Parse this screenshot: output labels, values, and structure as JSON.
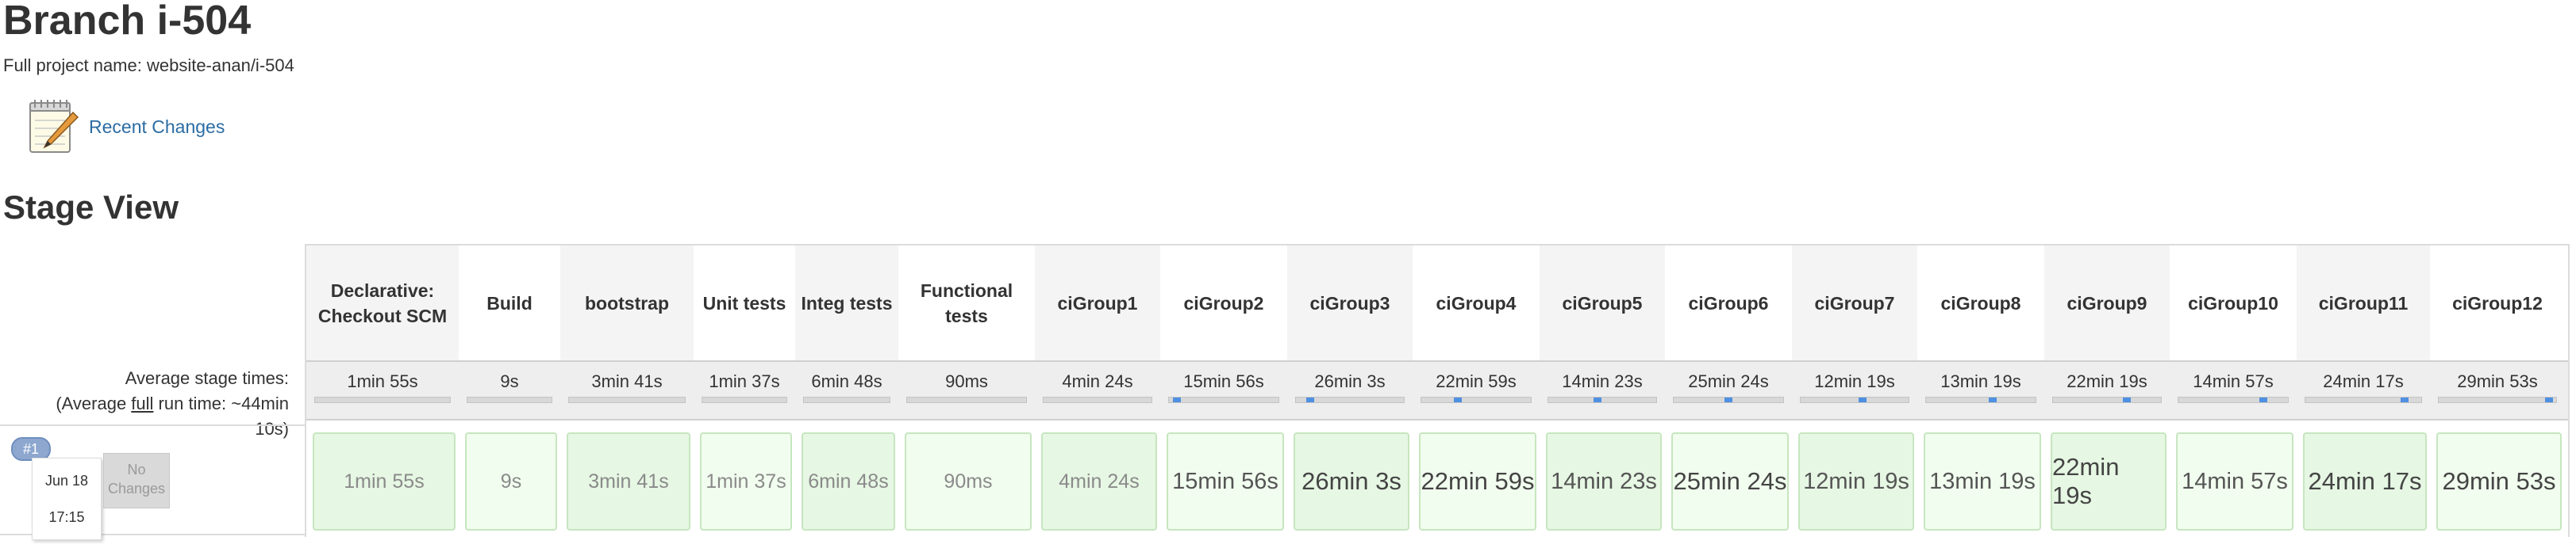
{
  "page": {
    "title": "Branch i-504",
    "full_name": "Full project name: website-anan/i-504",
    "recent_changes": "Recent Changes",
    "section_title": "Stage View"
  },
  "avg": {
    "line1": "Average stage times:",
    "line2_pre": "(Average ",
    "line2_link": "full",
    "line2_post": " run time: ~44min",
    "line3": "10s)"
  },
  "build": {
    "badge": "#1",
    "date": "Jun 18",
    "time": "17:15",
    "no_changes": "No Changes"
  },
  "stages": [
    {
      "name": "Declarative: Checkout SCM",
      "avg": "1min 55s",
      "run": "1min 55s",
      "progress": 0
    },
    {
      "name": "Build",
      "avg": "9s",
      "run": "9s",
      "progress": 0
    },
    {
      "name": "bootstrap",
      "avg": "3min 41s",
      "run": "3min 41s",
      "progress": 0
    },
    {
      "name": "Unit tests",
      "avg": "1min 37s",
      "run": "1min 37s",
      "progress": 0
    },
    {
      "name": "Integ tests",
      "avg": "6min 48s",
      "run": "6min 48s",
      "progress": 0
    },
    {
      "name": "Functional tests",
      "avg": "90ms",
      "run": "90ms",
      "progress": 0
    },
    {
      "name": "ciGroup1",
      "avg": "4min 24s",
      "run": "4min 24s",
      "progress": 0
    },
    {
      "name": "ciGroup2",
      "avg": "15min 56s",
      "run": "15min 56s",
      "progress": 0.04
    },
    {
      "name": "ciGroup3",
      "avg": "26min 3s",
      "run": "26min 3s",
      "progress": 0.1
    },
    {
      "name": "ciGroup4",
      "avg": "22min 59s",
      "run": "22min 59s",
      "progress": 0.32
    },
    {
      "name": "ciGroup5",
      "avg": "14min 23s",
      "run": "14min 23s",
      "progress": 0.45
    },
    {
      "name": "ciGroup6",
      "avg": "25min 24s",
      "run": "25min 24s",
      "progress": 0.5
    },
    {
      "name": "ciGroup7",
      "avg": "12min 19s",
      "run": "12min 19s",
      "progress": 0.58
    },
    {
      "name": "ciGroup8",
      "avg": "13min 19s",
      "run": "13min 19s",
      "progress": 0.62
    },
    {
      "name": "ciGroup9",
      "avg": "22min 19s",
      "run": "22min 19s",
      "progress": 0.7
    },
    {
      "name": "ciGroup10",
      "avg": "14min 57s",
      "run": "14min 57s",
      "progress": 0.8
    },
    {
      "name": "ciGroup11",
      "avg": "24min 17s",
      "run": "24min 17s",
      "progress": 0.88
    },
    {
      "name": "ciGroup12",
      "avg": "29min 53s",
      "run": "29min 53s",
      "progress": 0.97
    }
  ],
  "colors": {
    "link": "#2b6ca3",
    "success_cell": "#e6f7e3",
    "progress_fill": "#4e90e2",
    "badge": "#8da7cf"
  },
  "icons": {
    "recent_changes": "notepad-icon"
  }
}
